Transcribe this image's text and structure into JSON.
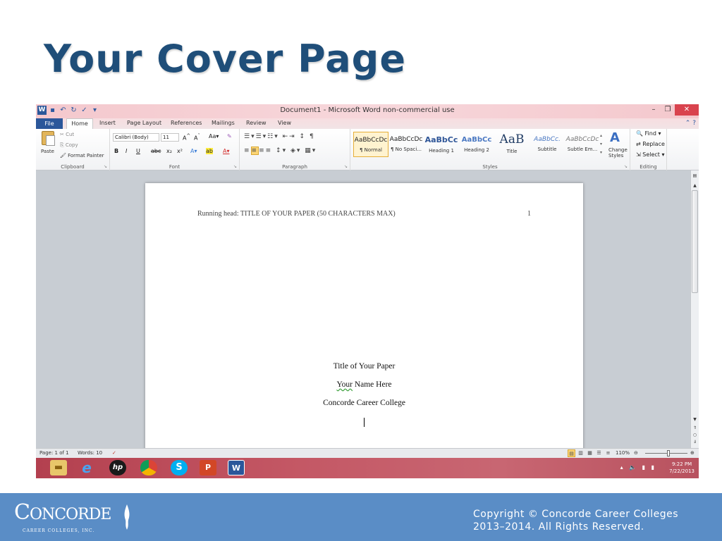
{
  "slide": {
    "title": "Your Cover Page",
    "copyright_line1": "Copyright © Concorde Career Colleges",
    "copyright_line2": "2013–2014. All Rights Reserved.",
    "logo_text": "ONCORDE",
    "logo_letter": "C",
    "logo_sub": "CAREER COLLEGES, INC."
  },
  "word": {
    "window_title": "Document1 - Microsoft Word non-commercial use",
    "tabs": [
      "File",
      "Home",
      "Insert",
      "Page Layout",
      "References",
      "Mailings",
      "Review",
      "View"
    ],
    "clipboard": {
      "paste": "Paste",
      "cut": "Cut",
      "copy": "Copy",
      "format_painter": "Format Painter",
      "label": "Clipboard"
    },
    "font": {
      "name": "Calibri (Body)",
      "size": "11",
      "label": "Font"
    },
    "paragraph": {
      "label": "Paragraph"
    },
    "styles": {
      "label": "Styles",
      "items": [
        {
          "sample": "AaBbCcDc",
          "name": "¶ Normal"
        },
        {
          "sample": "AaBbCcDc",
          "name": "¶ No Spaci..."
        },
        {
          "sample": "AaBbCc",
          "name": "Heading 1"
        },
        {
          "sample": "AaBbCc",
          "name": "Heading 2"
        },
        {
          "sample": "AaB",
          "name": "Title"
        },
        {
          "sample": "AaBbCc.",
          "name": "Subtitle"
        },
        {
          "sample": "AaBbCcDc",
          "name": "Subtle Em..."
        }
      ],
      "change_styles": "Change Styles"
    },
    "editing": {
      "find": "Find",
      "replace": "Replace",
      "select": "Select",
      "label": "Editing"
    },
    "document": {
      "running_head": "Running head: TITLE OF YOUR PAPER (50 CHARACTERS MAX)",
      "page_number": "1",
      "title": "Title of Your Paper",
      "author_first": "Your",
      "author_rest": " Name Here",
      "institution": "Concorde Career College"
    },
    "status": {
      "page": "Page: 1 of 1",
      "words": "Words: 10",
      "zoom": "110%",
      "zoom_level": 0.55
    },
    "taskbar": {
      "time": "9:22 PM",
      "date": "7/22/2013"
    }
  },
  "colors": {
    "title": "#1f4e79",
    "footer": "#5a8dc6",
    "word_blue": "#2b579a"
  }
}
